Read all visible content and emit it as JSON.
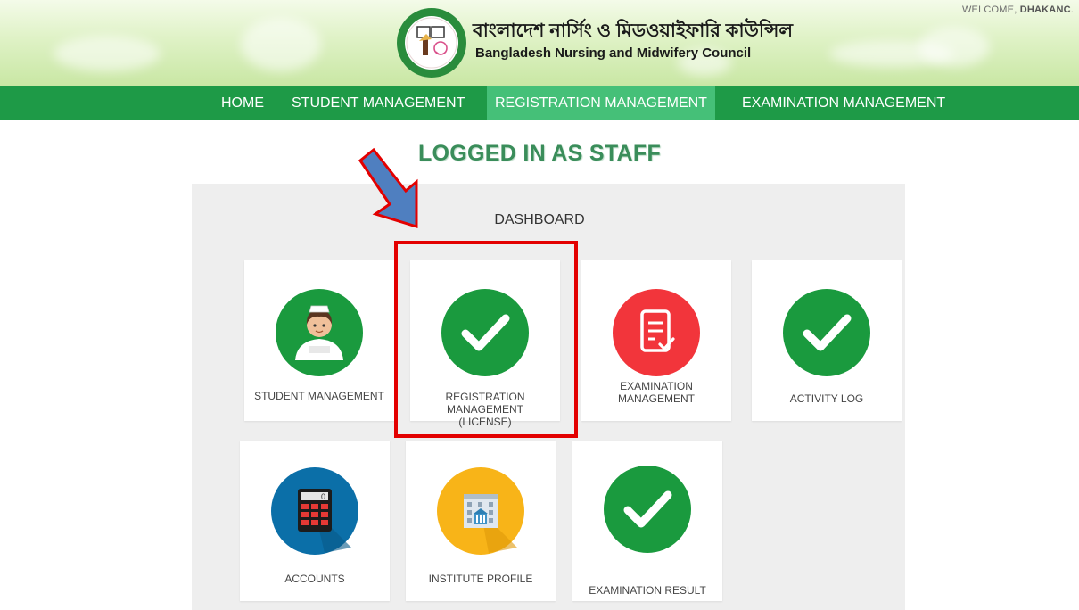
{
  "header": {
    "welcome_prefix": "WELCOME, ",
    "welcome_user": "DHAKANC",
    "welcome_suffix": ".",
    "brand_bangla": "বাংলাদেশ নার্সিং ও মিডওয়াইফারি কাউন্সিল",
    "brand_english": "Bangladesh Nursing and Midwifery Council"
  },
  "nav": {
    "items": [
      {
        "label": "HOME",
        "active": false
      },
      {
        "label": "STUDENT MANAGEMENT",
        "active": false
      },
      {
        "label": "REGISTRATION MANAGEMENT",
        "active": true
      },
      {
        "label": "EXAMINATION MANAGEMENT",
        "active": false
      }
    ]
  },
  "main": {
    "logged_in_text": "LOGGED IN AS STAFF",
    "dashboard_title": "DASHBOARD",
    "cards": [
      {
        "label": "STUDENT MANAGEMENT",
        "icon": "nurse-icon",
        "color": "#1a9a3e"
      },
      {
        "label": "REGISTRATION MANAGEMENT (LICENSE)",
        "icon": "checkmark-icon",
        "color": "#1a9a3e",
        "highlighted": true
      },
      {
        "label": "EXAMINATION MANAGEMENT",
        "icon": "document-check-icon",
        "color": "#f2353b"
      },
      {
        "label": "ACTIVITY LOG",
        "icon": "checkmark-icon",
        "color": "#1a9a3e"
      },
      {
        "label": "ACCOUNTS",
        "icon": "calculator-icon",
        "color": "#0b6fa8"
      },
      {
        "label": "INSTITUTE PROFILE",
        "icon": "institute-building-icon",
        "color": "#f8b418"
      },
      {
        "label": "EXAMINATION RESULT",
        "icon": "checkmark-icon",
        "color": "#1a9a3e"
      }
    ]
  },
  "colors": {
    "nav_green": "#1e9a47",
    "nav_active": "#45c078",
    "highlight_red": "#e30000",
    "arrow_blue": "#4f7fc0"
  }
}
